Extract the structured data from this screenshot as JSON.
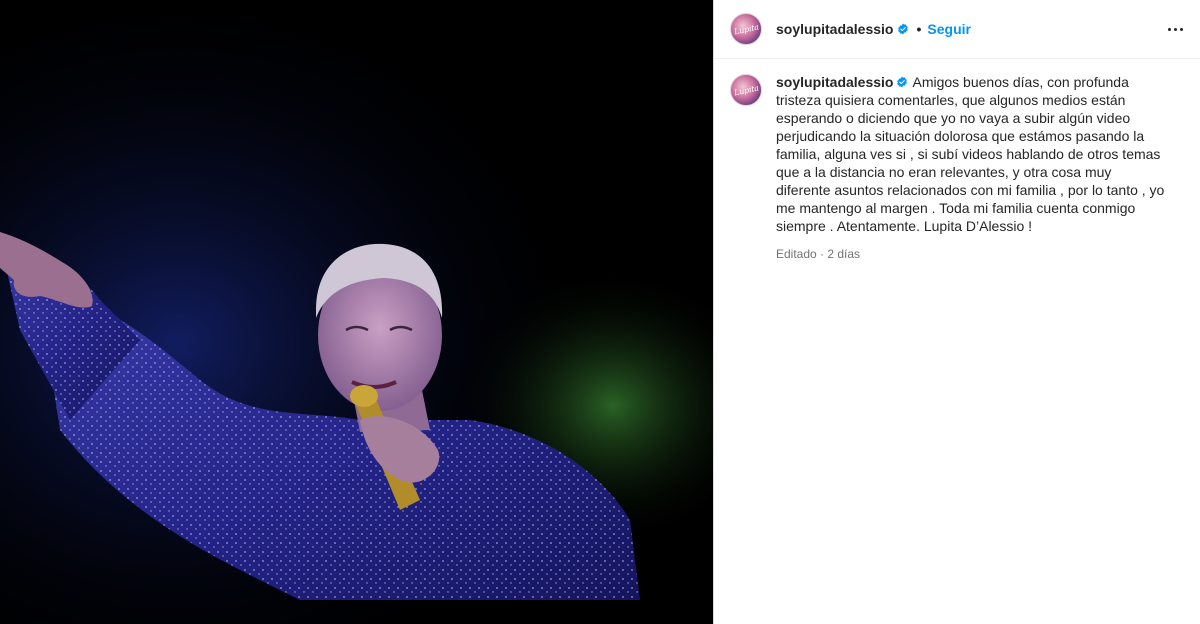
{
  "post": {
    "username": "soylupitadalessio",
    "follow_label": "Seguir",
    "separator": "•",
    "avatar_text": "Lupita"
  },
  "caption": {
    "username": "soylupitadalessio",
    "text": "Amigos buenos días, con profunda tristeza quisiera comentarles, que algunos medios están esperando o diciendo que yo no vaya a subir algún video perjudicando la situación dolorosa que estámos pasando la familia, alguna ves si , si subí videos hablando de otros temas que a la distancia no eran relevantes, y otra cosa muy diferente asuntos relacionados con mi familia , por lo tanto , yo me mantengo al margen . Toda mi familia cuenta conmigo siempre . Atentamente. Lupita D’Alessio !",
    "meta": "Editado · 2 días"
  },
  "icons": {
    "verified": "verified-badge-icon",
    "more": "more-options-icon"
  },
  "colors": {
    "link": "#0095f6",
    "verified": "#0095f6",
    "meta": "#737373",
    "text": "#262626"
  }
}
